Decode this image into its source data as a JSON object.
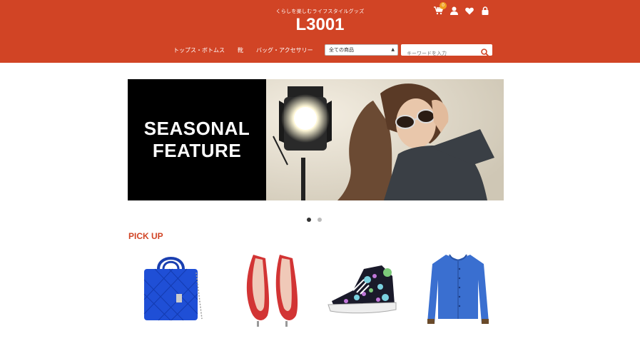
{
  "header": {
    "tagline": "くらしを楽しむライフスタイルグッズ",
    "logo": "L3001",
    "cart_count": "0",
    "icons": [
      "cart-icon",
      "user-icon",
      "heart-icon",
      "lock-icon"
    ],
    "accent_color": "#d14425"
  },
  "nav": {
    "items": [
      "トップス・ボトムス",
      "靴",
      "バッグ・アクセサリー"
    ]
  },
  "search": {
    "category_selected": "全ての商品",
    "placeholder": "キーワードを入力"
  },
  "hero": {
    "headline_line1": "SEASONAL",
    "headline_line2": "FEATURE",
    "slide_count": 2,
    "active_slide": 1
  },
  "pickup": {
    "title": "PICK UP",
    "products": [
      "blue-quilted-handbag",
      "red-high-heels",
      "printed-high-top-sneaker",
      "blue-cardigan"
    ]
  }
}
